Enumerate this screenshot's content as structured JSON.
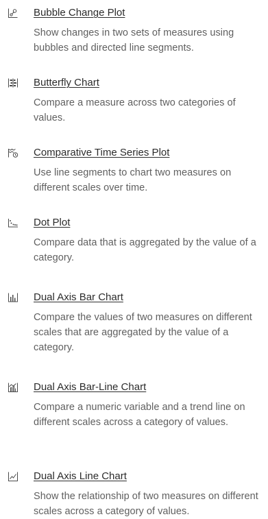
{
  "items": [
    {
      "title": "Bubble Change Plot",
      "description": "Show changes in two sets of measures using bubbles and directed line segments.",
      "icon": "bubble-change-plot-icon"
    },
    {
      "title": "Butterfly Chart",
      "description": "Compare a measure across two categories of values.",
      "icon": "butterfly-chart-icon"
    },
    {
      "title": "Comparative Time Series Plot",
      "description": "Use line segments to chart two measures on different scales over time.",
      "icon": "comparative-time-series-icon"
    },
    {
      "title": "Dot Plot",
      "description": "Compare data that is aggregated by the value of a category.",
      "icon": "dot-plot-icon"
    },
    {
      "title": "Dual Axis Bar Chart",
      "description": "Compare the values of two measures on different scales that are aggregated by the value of a category.",
      "icon": "dual-axis-bar-chart-icon"
    },
    {
      "title": "Dual Axis Bar-Line Chart",
      "description": "Compare a numeric variable and a trend line on different scales across a category of values.",
      "icon": "dual-axis-bar-line-chart-icon"
    },
    {
      "title": "Dual Axis Line Chart",
      "description": "Show the relationship of two measures on different scales across a category of values.",
      "icon": "dual-axis-line-chart-icon"
    }
  ]
}
